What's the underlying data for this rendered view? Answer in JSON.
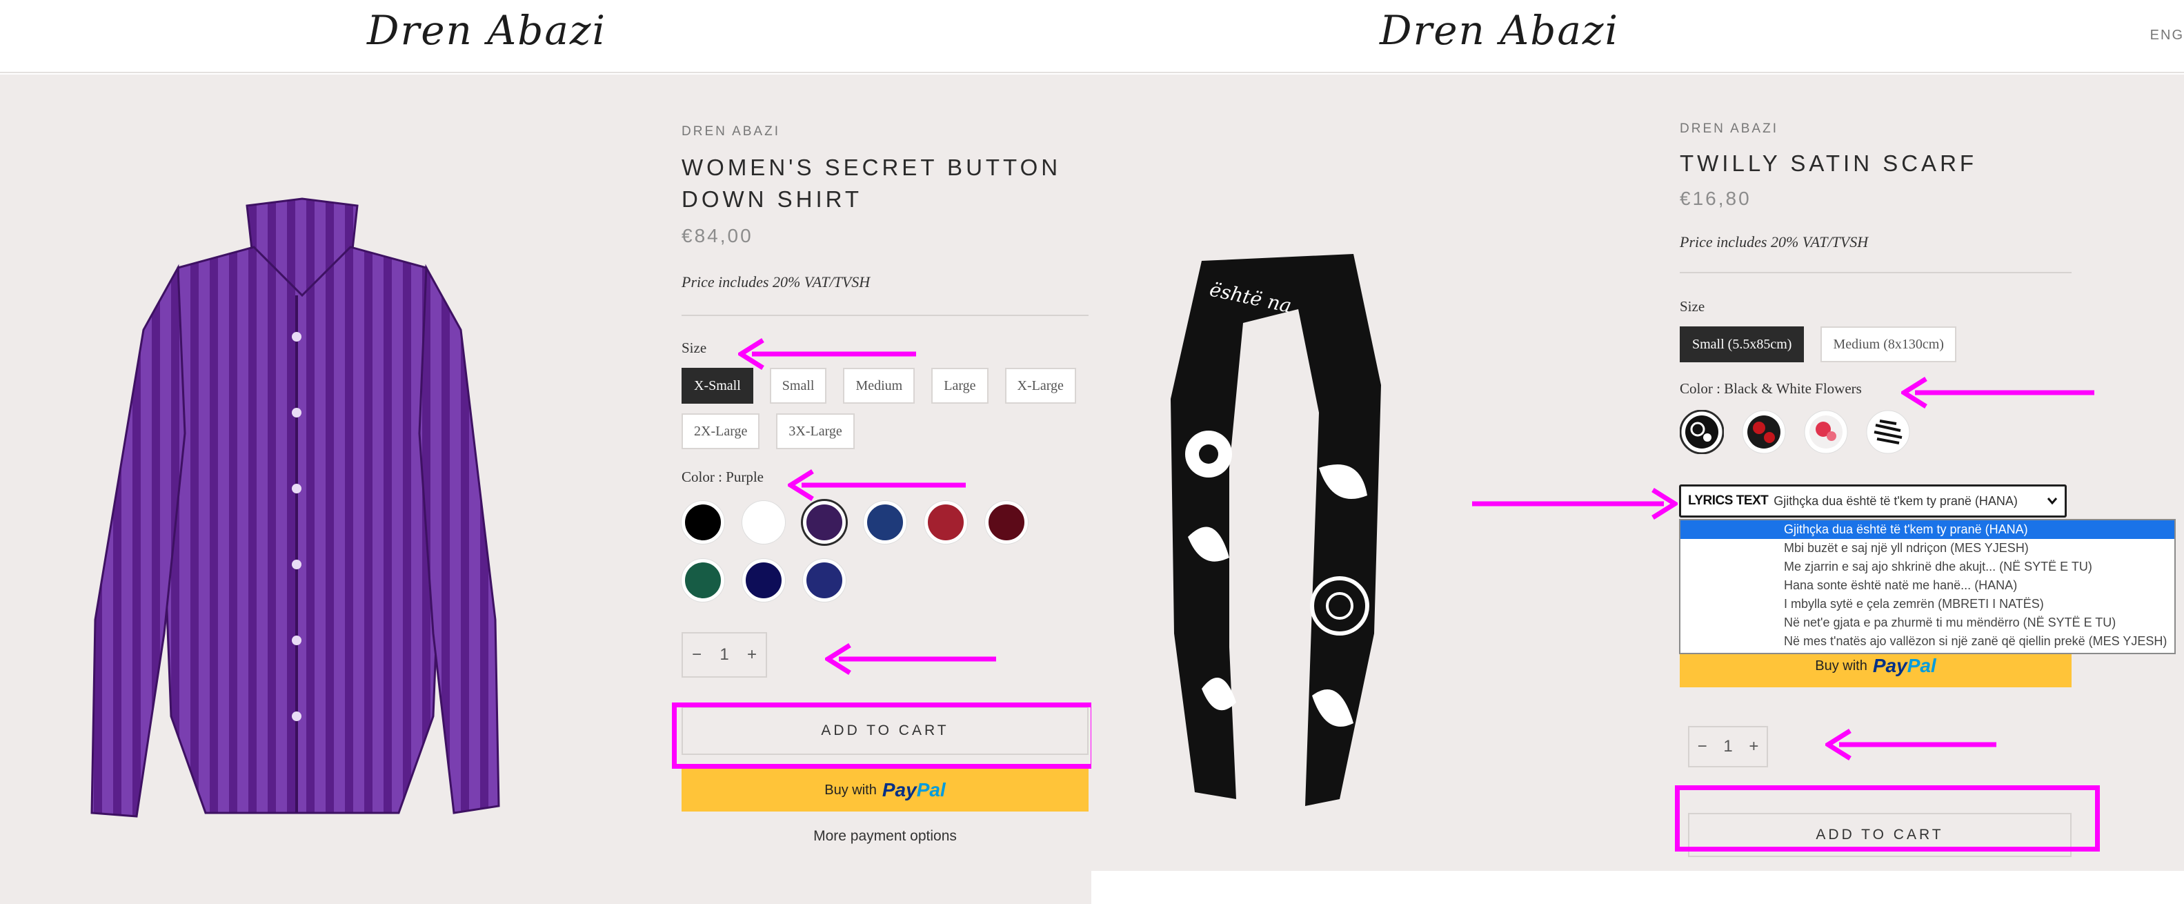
{
  "left": {
    "logo": "Dren Abazi",
    "vendor": "DREN ABAZI",
    "title_line1": "WOMEN'S SECRET BUTTON",
    "title_line2": "DOWN SHIRT",
    "price": "€84,00",
    "vat_note": "Price includes 20% VAT/TVSH",
    "size_label": "Size",
    "sizes": [
      "X-Small",
      "Small",
      "Medium",
      "Large",
      "X-Large",
      "2X-Large",
      "3X-Large"
    ],
    "selected_size": "X-Small",
    "color_label": "Color : Purple",
    "colors": [
      "#000000",
      "#ffffff",
      "#3b1c5c",
      "#1e3a7a",
      "#a3202f",
      "#5c0a18",
      "#175c45",
      "#0d0d58",
      "#222a78"
    ],
    "selected_color_index": 2,
    "qty_minus": "−",
    "qty_value": "1",
    "qty_plus": "+",
    "add_to_cart": "ADD TO CART",
    "paypal_prefix": "Buy with",
    "paypal_brand_a": "Pay",
    "paypal_brand_b": "Pal",
    "more_payment": "More payment options"
  },
  "right": {
    "logo": "Dren Abazi",
    "language": "ENG",
    "vendor": "DREN ABAZI",
    "title": "TWILLY SATIN SCARF",
    "price": "€16,80",
    "vat_note": "Price includes 20% VAT/TVSH",
    "size_label": "Size",
    "sizes": [
      "Small (5.5x85cm)",
      "Medium (8x130cm)"
    ],
    "selected_size": "Small (5.5x85cm)",
    "color_label": "Color : Black & White Flowers",
    "selected_color_index": 0,
    "lyrics_label": "LYRICS TEXT",
    "lyrics_value": "Gjithçka dua është të t'kem ty pranë (HANA)",
    "lyrics_options": [
      "Gjithçka dua është të t'kem ty pranë (HANA)",
      "Mbi buzët e saj një yll ndriçon (MES YJESH)",
      "Me zjarrin e saj ajo shkrinë dhe akujt... (NË SYTË E TU)",
      "Hana sonte është natë me hanë... (HANA)",
      "I mbylla sytë e çela zemrën (MBRETI I NATËS)",
      "Në net'e gjata e pa zhurmë ti mu mëndërro (NË SYTË E TU)",
      "Në mes t'natës ajo vallëzon si një zanë që qiellin prekë (MES YJESH)"
    ],
    "paypal_prefix": "Buy with",
    "paypal_brand_a": "Pay",
    "paypal_brand_b": "Pal",
    "qty_minus": "−",
    "qty_value": "1",
    "qty_plus": "+",
    "add_to_cart": "ADD TO CART",
    "scarf_text": "është na"
  },
  "annotation_color": "#ff00ff"
}
